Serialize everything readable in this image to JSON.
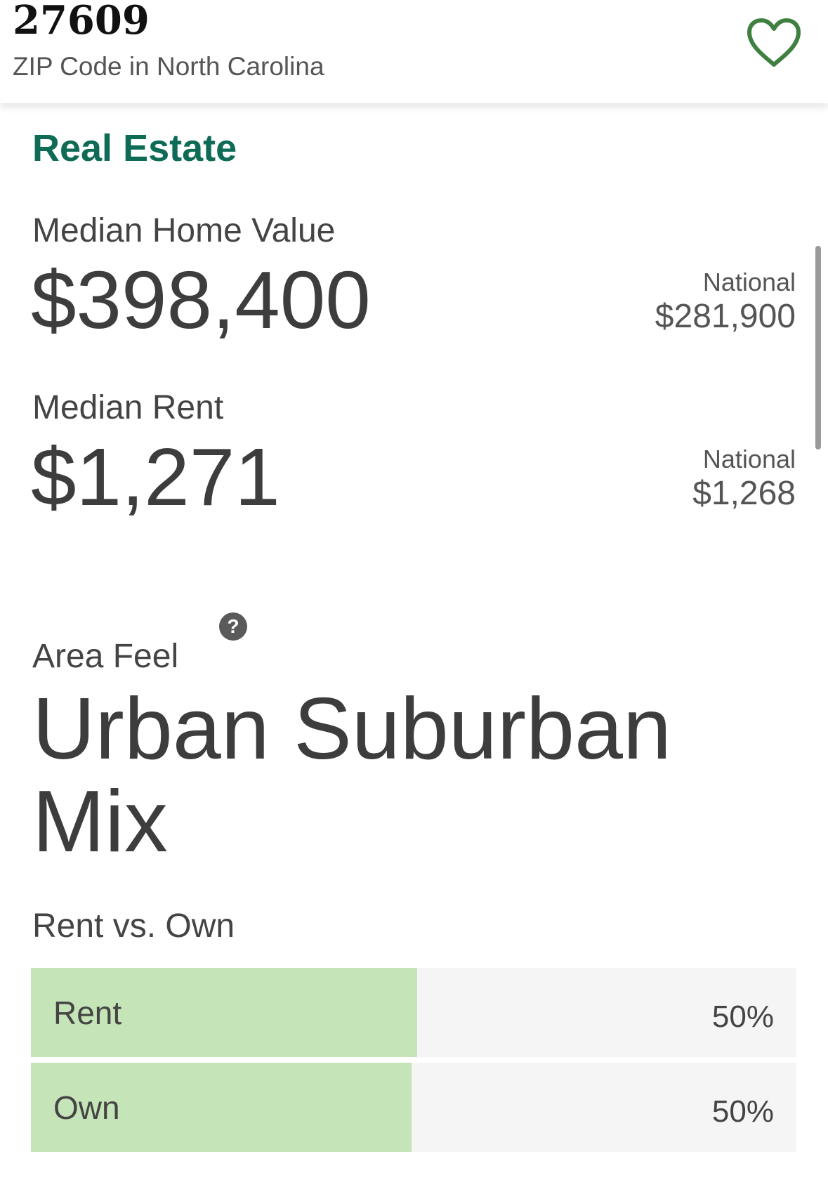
{
  "header": {
    "title": "27609",
    "subtitle": "ZIP Code in North Carolina",
    "favorite_icon": "heart-outline-icon",
    "accent_color": "#3f7f3f"
  },
  "real_estate": {
    "section_title": "Real Estate",
    "section_color": "#0e6b55",
    "median_home_value": {
      "label": "Median Home Value",
      "value": "$398,400",
      "national_label": "National",
      "national_value": "$281,900"
    },
    "median_rent": {
      "label": "Median Rent",
      "value": "$1,271",
      "national_label": "National",
      "national_value": "$1,268"
    }
  },
  "area_feel": {
    "label": "Area Feel",
    "value": "Urban Suburban Mix",
    "help_icon": "question-circle-icon",
    "help_glyph": "?"
  },
  "rent_vs_own": {
    "label": "Rent vs. Own",
    "fill_color": "#c5e4b8",
    "rows": [
      {
        "label": "Rent",
        "percent_text": "50%",
        "fraction": 0.505
      },
      {
        "label": "Own",
        "percent_text": "50%",
        "fraction": 0.497
      }
    ]
  }
}
